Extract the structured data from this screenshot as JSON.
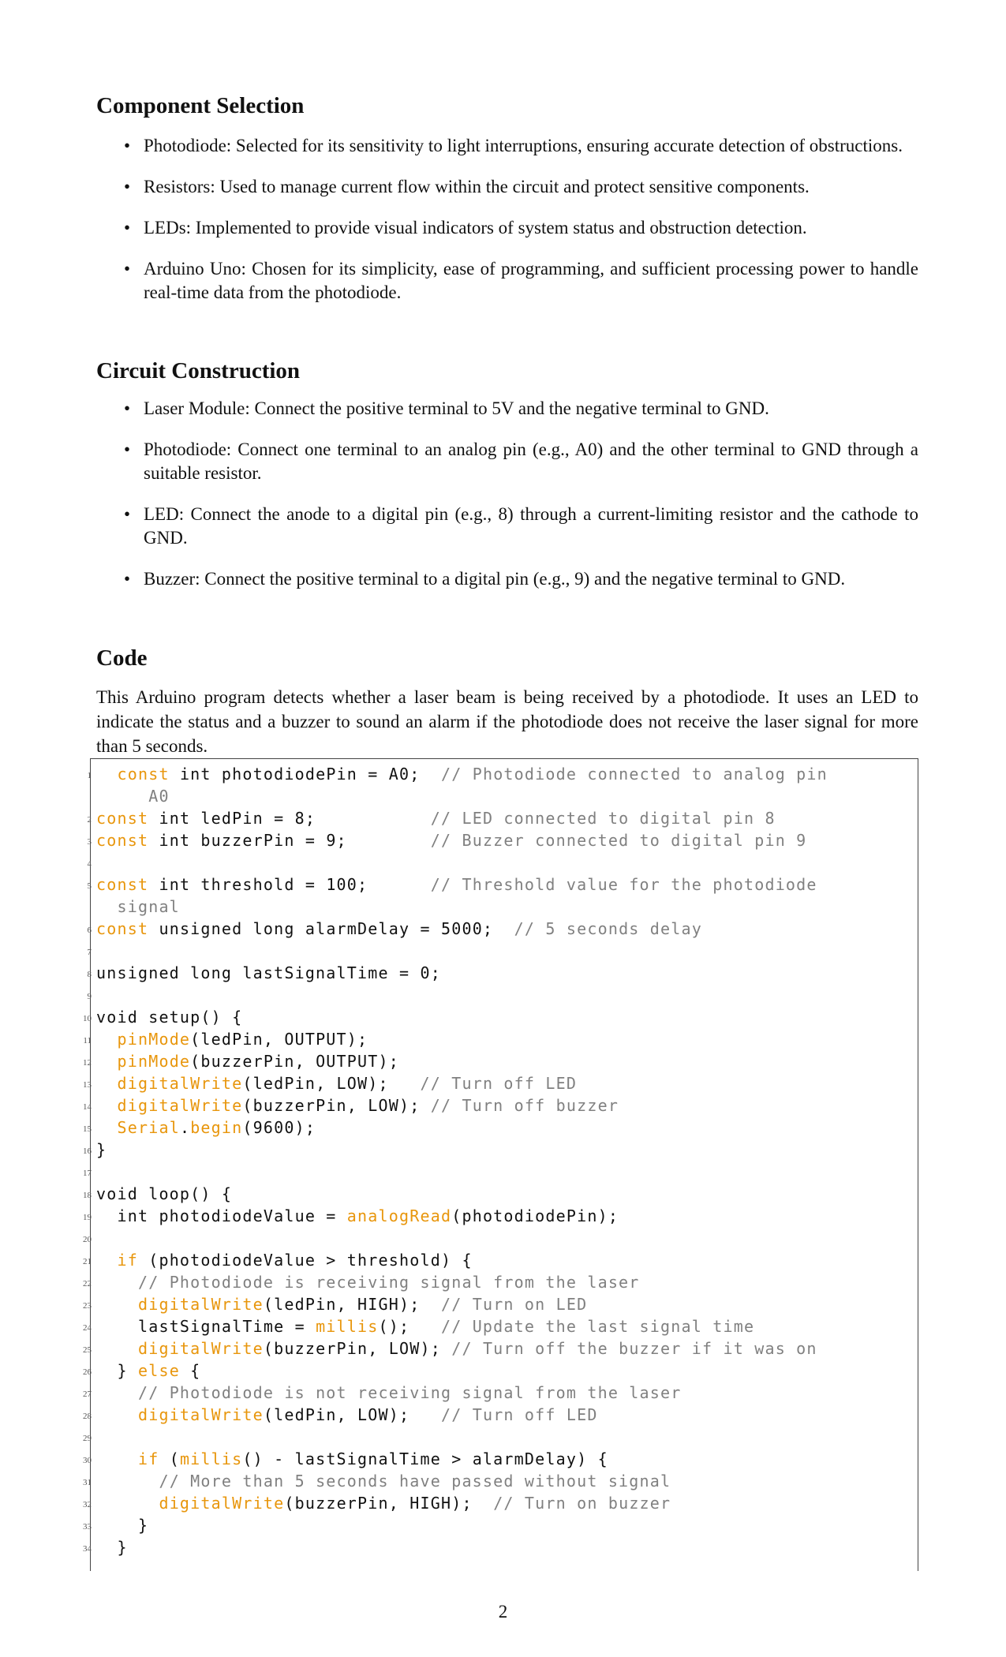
{
  "sections": {
    "component_selection": {
      "heading": "Component Selection",
      "items": [
        "Photodiode: Selected for its sensitivity to light interruptions, ensuring accurate detection of obstructions.",
        "Resistors: Used to manage current flow within the circuit and protect sensitive components.",
        "LEDs: Implemented to provide visual indicators of system status and obstruction detection.",
        "Arduino Uno: Chosen for its simplicity, ease of programming, and sufficient processing power to handle real-time data from the photodiode."
      ]
    },
    "circuit_construction": {
      "heading": "Circuit Construction",
      "items": [
        "Laser Module: Connect the positive terminal to 5V and the negative terminal to GND.",
        "Photodiode: Connect one terminal to an analog pin (e.g., A0) and the other terminal to GND through a suitable resistor.",
        "LED: Connect the anode to a digital pin (e.g., 8) through a current-limiting resistor and the cathode to GND.",
        "Buzzer: Connect the positive terminal to a digital pin (e.g., 9) and the negative terminal to GND."
      ]
    },
    "code": {
      "heading": "Code",
      "intro": "This Arduino program detects whether a laser beam is being received by a photodiode. It uses an LED to indicate the status and a buzzer to sound an alarm if the photodiode does not receive the laser signal for more than 5 seconds."
    }
  },
  "code_lines": [
    {
      "n": "1",
      "wrap": true,
      "segs": [
        [
          "t",
          "  "
        ],
        [
          "k",
          "const"
        ],
        [
          "t",
          " int photodiodePin = A0;  "
        ],
        [
          "c",
          "// Photodiode connected to analog pin\n     A0"
        ]
      ]
    },
    {
      "n": "2",
      "segs": [
        [
          "k",
          "const"
        ],
        [
          "t",
          " int ledPin = 8;           "
        ],
        [
          "c",
          "// LED connected to digital pin 8"
        ]
      ]
    },
    {
      "n": "3",
      "segs": [
        [
          "k",
          "const"
        ],
        [
          "t",
          " int buzzerPin = 9;        "
        ],
        [
          "c",
          "// Buzzer connected to digital pin 9"
        ]
      ]
    },
    {
      "n": "4",
      "segs": []
    },
    {
      "n": "5",
      "wrap": true,
      "segs": [
        [
          "k",
          "const"
        ],
        [
          "t",
          " int threshold = 100;      "
        ],
        [
          "c",
          "// Threshold value for the photodiode\n  signal"
        ]
      ]
    },
    {
      "n": "6",
      "segs": [
        [
          "k",
          "const"
        ],
        [
          "t",
          " unsigned long alarmDelay = 5000;  "
        ],
        [
          "c",
          "// 5 seconds delay"
        ]
      ]
    },
    {
      "n": "7",
      "segs": []
    },
    {
      "n": "8",
      "segs": [
        [
          "t",
          "unsigned long lastSignalTime = 0;"
        ]
      ]
    },
    {
      "n": "9",
      "segs": []
    },
    {
      "n": "10",
      "segs": [
        [
          "t",
          "void setup() {"
        ]
      ]
    },
    {
      "n": "11",
      "segs": [
        [
          "t",
          "  "
        ],
        [
          "k",
          "pinMode"
        ],
        [
          "t",
          "(ledPin, OUTPUT);"
        ]
      ]
    },
    {
      "n": "12",
      "segs": [
        [
          "t",
          "  "
        ],
        [
          "k",
          "pinMode"
        ],
        [
          "t",
          "(buzzerPin, OUTPUT);"
        ]
      ]
    },
    {
      "n": "13",
      "segs": [
        [
          "t",
          "  "
        ],
        [
          "k",
          "digitalWrite"
        ],
        [
          "t",
          "(ledPin, LOW);   "
        ],
        [
          "c",
          "// Turn off LED"
        ]
      ]
    },
    {
      "n": "14",
      "segs": [
        [
          "t",
          "  "
        ],
        [
          "k",
          "digitalWrite"
        ],
        [
          "t",
          "(buzzerPin, LOW); "
        ],
        [
          "c",
          "// Turn off buzzer"
        ]
      ]
    },
    {
      "n": "15",
      "segs": [
        [
          "t",
          "  "
        ],
        [
          "k",
          "Serial"
        ],
        [
          "t",
          "."
        ],
        [
          "k",
          "begin"
        ],
        [
          "t",
          "(9600);"
        ]
      ]
    },
    {
      "n": "16",
      "segs": [
        [
          "t",
          "}"
        ]
      ]
    },
    {
      "n": "17",
      "segs": []
    },
    {
      "n": "18",
      "segs": [
        [
          "t",
          "void loop() {"
        ]
      ]
    },
    {
      "n": "19",
      "segs": [
        [
          "t",
          "  int photodiodeValue = "
        ],
        [
          "k",
          "analogRead"
        ],
        [
          "t",
          "(photodiodePin);"
        ]
      ]
    },
    {
      "n": "20",
      "segs": []
    },
    {
      "n": "21",
      "segs": [
        [
          "t",
          "  "
        ],
        [
          "k",
          "if"
        ],
        [
          "t",
          " (photodiodeValue > threshold) {"
        ]
      ]
    },
    {
      "n": "22",
      "segs": [
        [
          "t",
          "    "
        ],
        [
          "c",
          "// Photodiode is receiving signal from the laser"
        ]
      ]
    },
    {
      "n": "23",
      "segs": [
        [
          "t",
          "    "
        ],
        [
          "k",
          "digitalWrite"
        ],
        [
          "t",
          "(ledPin, HIGH);  "
        ],
        [
          "c",
          "// Turn on LED"
        ]
      ]
    },
    {
      "n": "24",
      "segs": [
        [
          "t",
          "    lastSignalTime = "
        ],
        [
          "k",
          "millis"
        ],
        [
          "t",
          "();   "
        ],
        [
          "c",
          "// Update the last signal time"
        ]
      ]
    },
    {
      "n": "25",
      "segs": [
        [
          "t",
          "    "
        ],
        [
          "k",
          "digitalWrite"
        ],
        [
          "t",
          "(buzzerPin, LOW); "
        ],
        [
          "c",
          "// Turn off the buzzer if it was on"
        ]
      ]
    },
    {
      "n": "26",
      "segs": [
        [
          "t",
          "  } "
        ],
        [
          "k",
          "else"
        ],
        [
          "t",
          " {"
        ]
      ]
    },
    {
      "n": "27",
      "segs": [
        [
          "t",
          "    "
        ],
        [
          "c",
          "// Photodiode is not receiving signal from the laser"
        ]
      ]
    },
    {
      "n": "28",
      "segs": [
        [
          "t",
          "    "
        ],
        [
          "k",
          "digitalWrite"
        ],
        [
          "t",
          "(ledPin, LOW);   "
        ],
        [
          "c",
          "// Turn off LED"
        ]
      ]
    },
    {
      "n": "29",
      "segs": []
    },
    {
      "n": "30",
      "segs": [
        [
          "t",
          "    "
        ],
        [
          "k",
          "if"
        ],
        [
          "t",
          " ("
        ],
        [
          "k",
          "millis"
        ],
        [
          "t",
          "() - lastSignalTime > alarmDelay) {"
        ]
      ]
    },
    {
      "n": "31",
      "segs": [
        [
          "t",
          "      "
        ],
        [
          "c",
          "// More than 5 seconds have passed without signal"
        ]
      ]
    },
    {
      "n": "32",
      "segs": [
        [
          "t",
          "      "
        ],
        [
          "k",
          "digitalWrite"
        ],
        [
          "t",
          "(buzzerPin, HIGH);  "
        ],
        [
          "c",
          "// Turn on buzzer"
        ]
      ]
    },
    {
      "n": "33",
      "segs": [
        [
          "t",
          "    }"
        ]
      ]
    },
    {
      "n": "34",
      "segs": [
        [
          "t",
          "  }"
        ]
      ]
    }
  ],
  "colors": {
    "keyword": "#e8960c",
    "comment": "#808080"
  },
  "page_number": "2"
}
